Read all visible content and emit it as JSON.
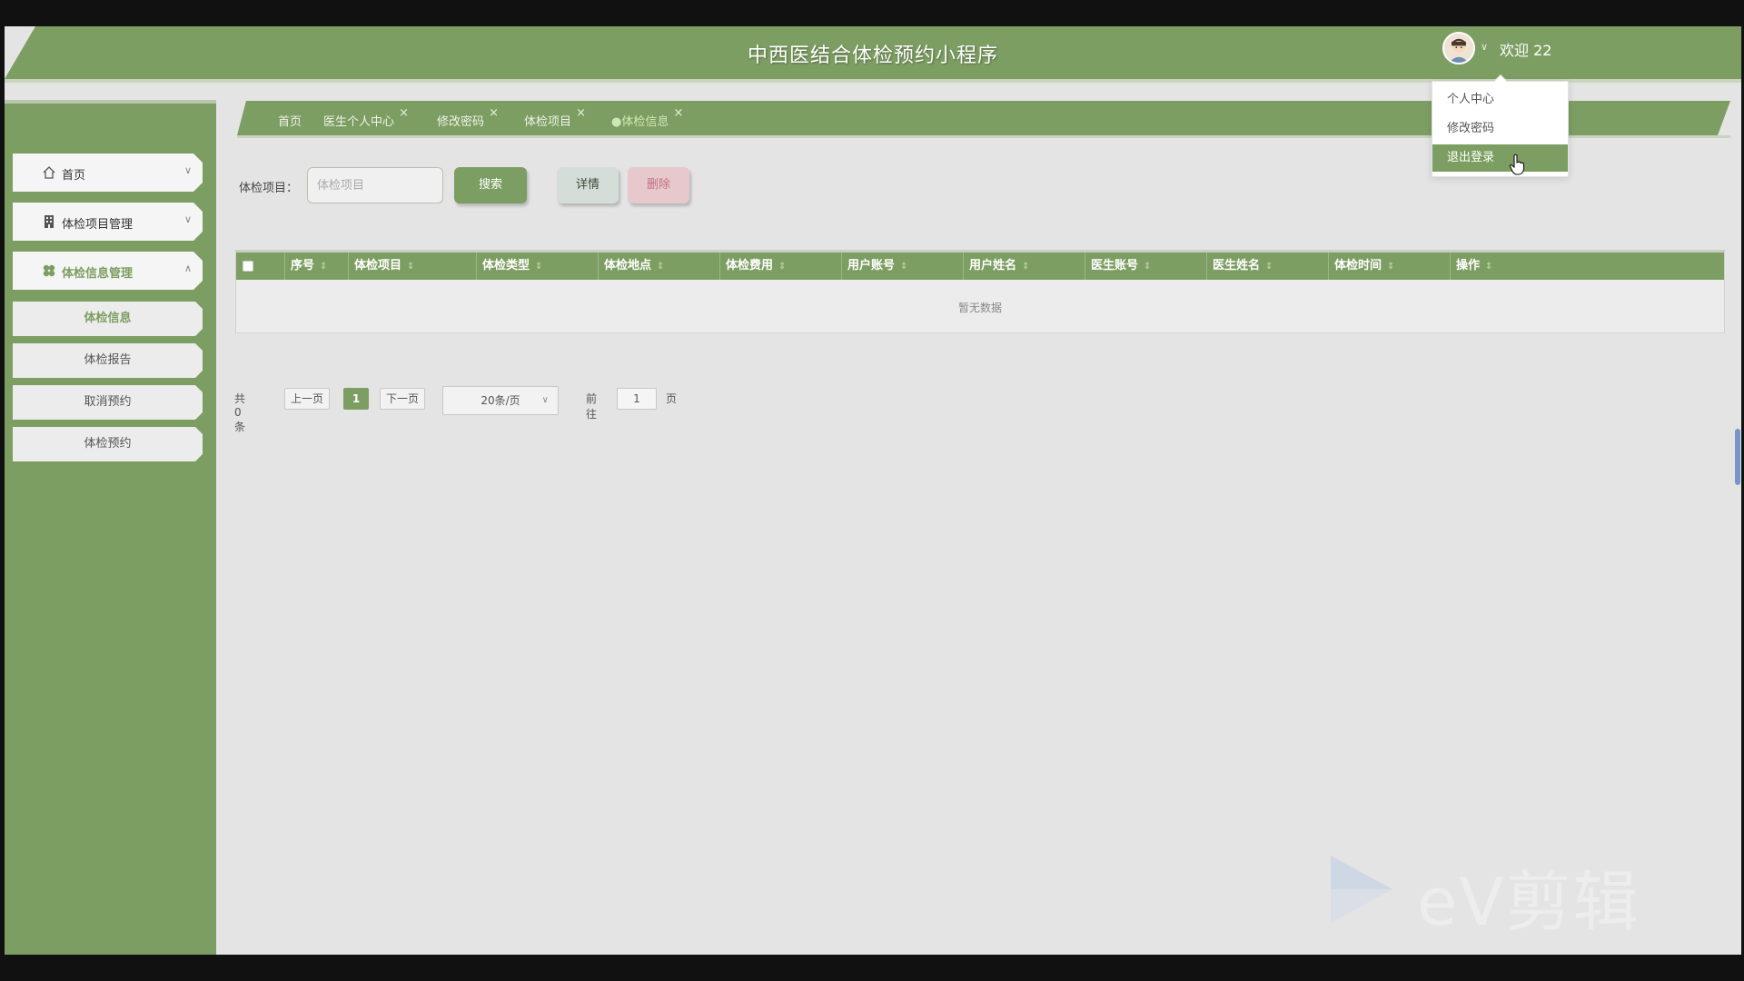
{
  "header": {
    "title": "中西医结合体检预约小程序",
    "welcome": "欢迎 22"
  },
  "user_menu": {
    "items": [
      "个人中心",
      "修改密码",
      "退出登录"
    ]
  },
  "sidebar": {
    "main": [
      {
        "label": "首页",
        "icon": "home-icon"
      },
      {
        "label": "体检项目管理",
        "icon": "building-icon"
      },
      {
        "label": "体检信息管理",
        "icon": "clover-icon"
      }
    ],
    "sub": [
      "体检信息",
      "体检报告",
      "取消预约",
      "体检预约"
    ]
  },
  "tabs": [
    "首页",
    "医生个人中心",
    "修改密码",
    "体检项目",
    "●体检信息"
  ],
  "tab_close_glyph": "×",
  "search": {
    "label": "体检项目：",
    "placeholder": "体检项目",
    "search_btn": "搜索",
    "detail_btn": "详情",
    "delete_btn": "删除"
  },
  "table": {
    "columns": [
      "序号",
      "体检项目",
      "体检类型",
      "体检地点",
      "体检费用",
      "用户账号",
      "用户姓名",
      "医生账号",
      "医生姓名",
      "体检时间",
      "操作"
    ],
    "empty_text": "暂无数据"
  },
  "pagination": {
    "total": "共 0 条",
    "prev": "上一页",
    "current": "1",
    "next": "下一页",
    "page_size": "20条/页",
    "goto": "前往",
    "goto_value": "1",
    "page_suffix": "页"
  },
  "watermark": "eV剪辑",
  "colors": {
    "primary": "#7d9e62",
    "background": "#e4e4e4"
  }
}
